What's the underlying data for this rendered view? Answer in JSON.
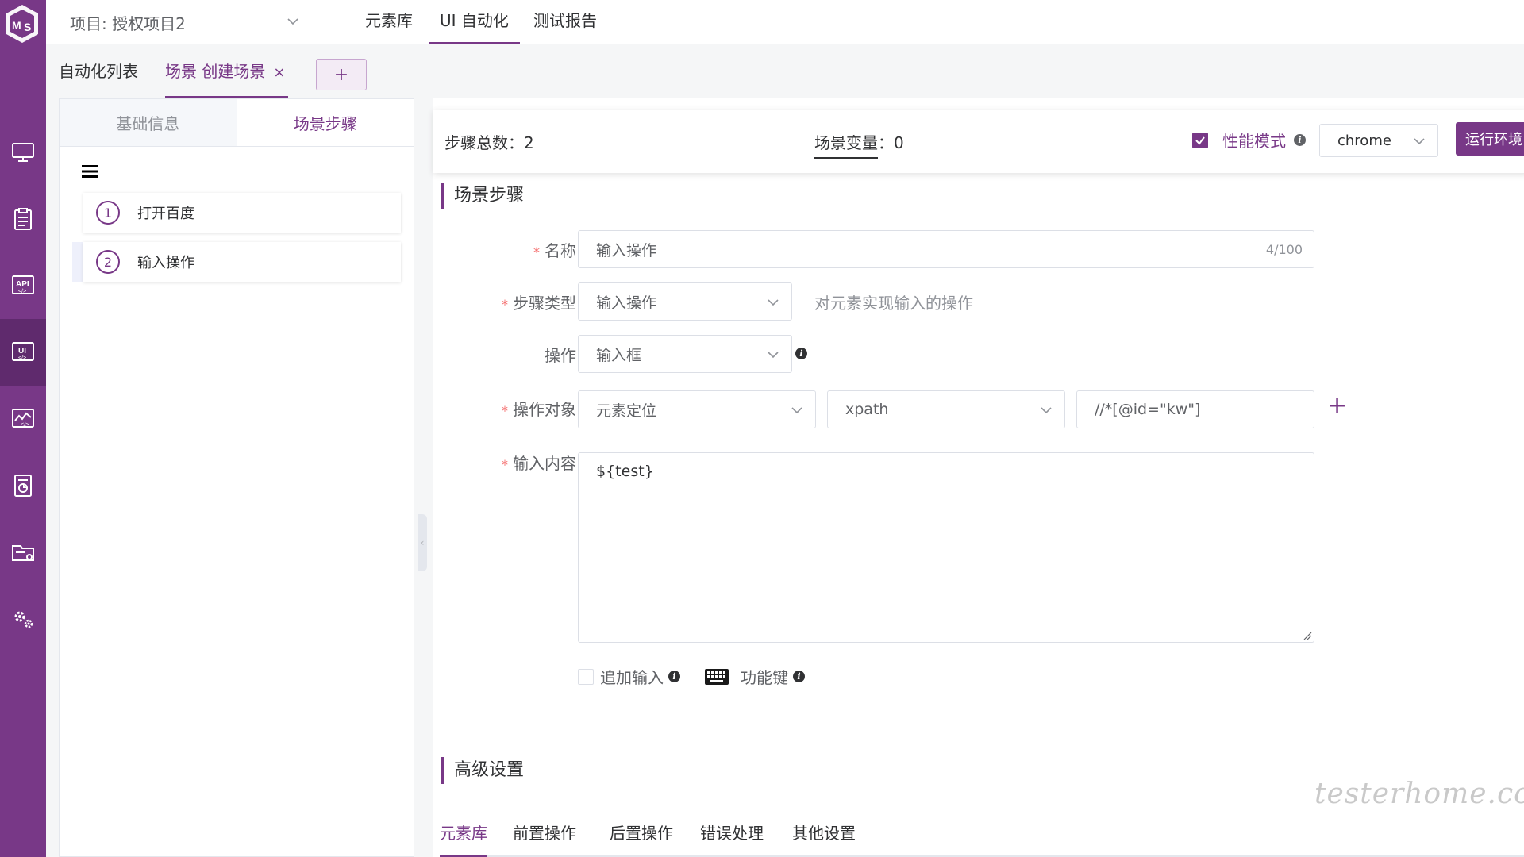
{
  "header": {
    "project_label": "项目: 授权项目2",
    "nav": [
      "元素库",
      "UI 自动化",
      "测试报告"
    ]
  },
  "tabs": {
    "list": "自动化列表",
    "scene": "场景 创建场景",
    "close": "×",
    "add": "+"
  },
  "left": {
    "sub_tabs": [
      "基础信息",
      "场景步骤"
    ],
    "steps": [
      {
        "num": "1",
        "label": "打开百度"
      },
      {
        "num": "2",
        "label": "输入操作"
      }
    ]
  },
  "summary": {
    "total_label": "步骤总数：",
    "total": "2",
    "var_label": "场景变量",
    "var_sep": "：",
    "var_count": "0",
    "perf_label": "性能模式",
    "browser": "chrome",
    "run_env": "运行环境"
  },
  "form": {
    "section_title": "场景步骤",
    "name_label": "名称",
    "name_value": "输入操作",
    "name_counter": "4/100",
    "type_label": "步骤类型",
    "type_value": "输入操作",
    "type_hint": "对元素实现输入的操作",
    "op_label": "操作",
    "op_value": "输入框",
    "target_label": "操作对象",
    "target_value": "元素定位",
    "locator_type": "xpath",
    "locator_value": "//*[@id=\"kw\"]",
    "content_label": "输入内容",
    "content_value": "${test}",
    "append_label": "追加输入",
    "funckey_label": "功能键",
    "required_mark": "*"
  },
  "advanced": {
    "title": "高级设置",
    "tabs": [
      "元素库",
      "前置操作",
      "后置操作",
      "错误处理",
      "其他设置"
    ]
  },
  "watermark": "testerhome.com",
  "colors": {
    "brand": "#783887",
    "required": "#f56c6c"
  }
}
